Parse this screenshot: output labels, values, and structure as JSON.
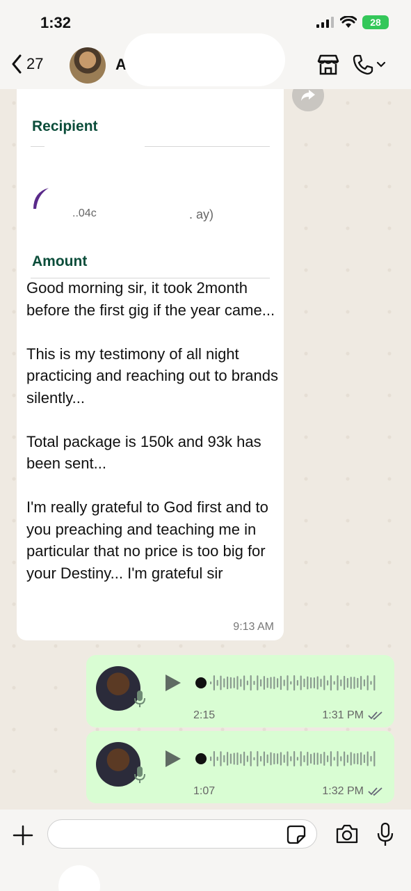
{
  "status_bar": {
    "time": "1:32",
    "battery": "28"
  },
  "header": {
    "back_count": "27",
    "contact_name": "A"
  },
  "message": {
    "recipient_label": "Recipient",
    "redacted_left": "..04c",
    "redacted_right": ". ay)",
    "amount_label": "Amount",
    "text": "Good morning sir, it took 2month before the first gig if the year came...\n\nThis is my testimony of all night practicing and reaching out to brands silently...\n\nTotal package is 150k and 93k has been sent...\n\nI'm really grateful to God first and to you preaching and teaching me in particular that no price is too big for your Destiny... I'm grateful sir",
    "time": "9:13 AM"
  },
  "voice_notes": [
    {
      "duration": "2:15",
      "time": "1:31 PM"
    },
    {
      "duration": "1:07",
      "time": "1:32 PM"
    }
  ],
  "input": {
    "placeholder": ""
  },
  "colors": {
    "outgoing_bubble": "#d9fdd3",
    "label_green": "#0b4d3a",
    "battery": "#34c759"
  }
}
